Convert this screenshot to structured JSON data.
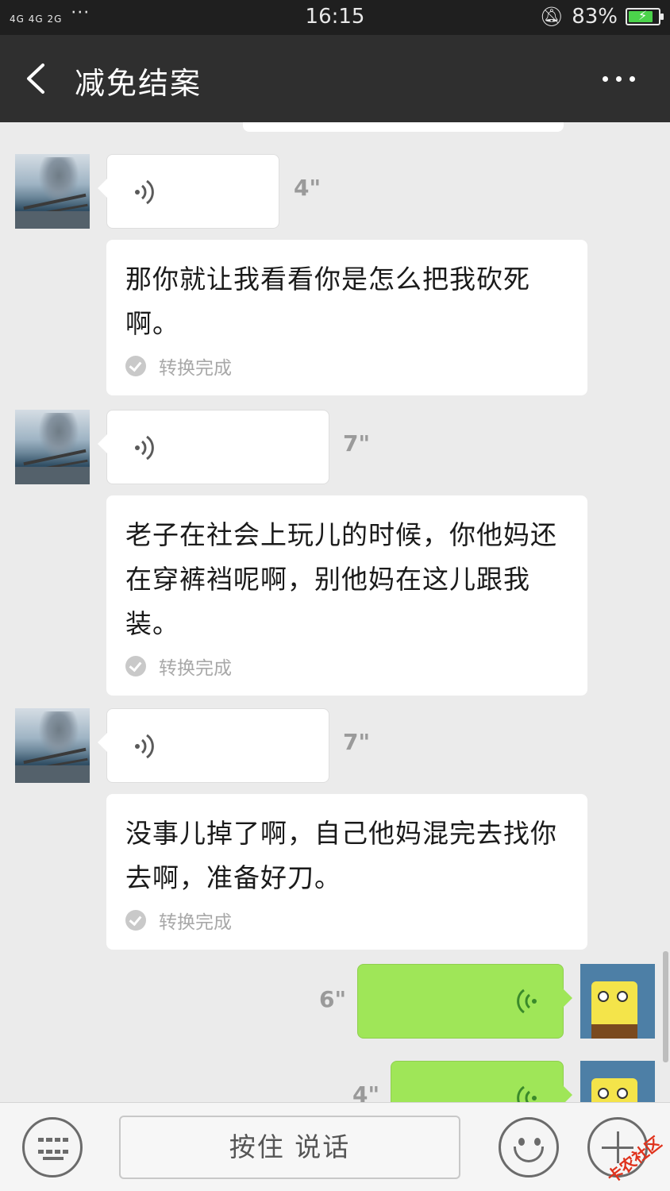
{
  "status_bar": {
    "network": "4G 4G 2G",
    "time": "16:15",
    "battery": "83%",
    "battery_level": 0.83,
    "icons": [
      "signal-icon",
      "more-dots-icon",
      "bell-mute-icon",
      "battery-icon"
    ]
  },
  "header": {
    "title": "减免结案",
    "back_icon": "chevron-left-icon",
    "more_icon": "more-horizontal-icon"
  },
  "messages": [
    {
      "type": "voice_in",
      "duration": "4\"",
      "text": "那你就让我看看你是怎么把我砍死啊。",
      "status": "转换完成"
    },
    {
      "type": "voice_in",
      "duration": "7\"",
      "text": "老子在社会上玩儿的时候，你他妈还在穿裤裆呢啊，别他妈在这儿跟我装。",
      "status": "转换完成"
    },
    {
      "type": "voice_in",
      "duration": "7\"",
      "text": "没事儿掉了啊，自己他妈混完去找你去啊，准备好刀。",
      "status": "转换完成"
    },
    {
      "type": "voice_out",
      "duration": "6\""
    },
    {
      "type": "voice_out",
      "duration": "4\""
    }
  ],
  "input_bar": {
    "talk_label": "按住 说话",
    "keyboard_icon": "keyboard-icon",
    "emoji_icon": "emoji-icon",
    "plus_icon": "plus-icon",
    "watermark": "卡农社区"
  },
  "colors": {
    "title_bar": "#2f2f2f",
    "chat_bg": "#ebebeb",
    "outgoing_bubble": "#9fe658",
    "incoming_bubble": "#ffffff"
  }
}
